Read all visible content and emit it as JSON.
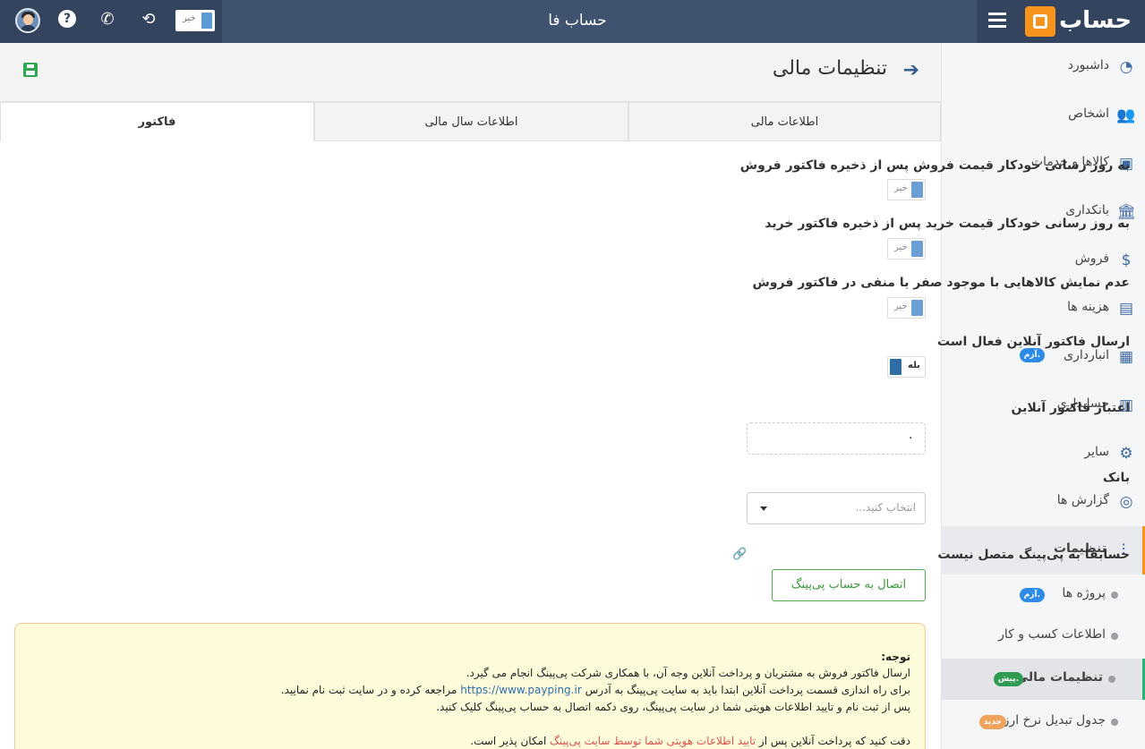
{
  "app_title": "حساب فا",
  "topbar": {
    "toggle_label": "خیر",
    "icons": [
      "avatar",
      "help-icon",
      "phone-icon",
      "refresh-icon"
    ]
  },
  "logo": {
    "text": "حساب"
  },
  "sidebar": {
    "items": [
      {
        "label": "داشبورد",
        "icon": "dashboard-icon"
      },
      {
        "label": "اشخاص",
        "icon": "people-icon"
      },
      {
        "label": "کالاها و خدمات",
        "icon": "box-icon"
      },
      {
        "label": "بانکداری",
        "icon": "bank-icon"
      },
      {
        "label": "فروش",
        "icon": "sales-icon"
      },
      {
        "label": "هزینه ها",
        "icon": "wallet-icon"
      },
      {
        "label": "انبارداری",
        "icon": "warehouse-icon",
        "badge": "آزم."
      },
      {
        "label": "حسابداری",
        "icon": "calculator-icon"
      },
      {
        "label": "سایر",
        "icon": "other-icon"
      },
      {
        "label": "گزارش ها",
        "icon": "report-icon"
      },
      {
        "label": "تنظیمات",
        "icon": "settings-icon"
      }
    ],
    "sub_items": [
      {
        "label": "پروژه ها",
        "badge": "آزم."
      },
      {
        "label": "اطلاعات کسب و کار"
      },
      {
        "label": "تنظیمات مالی",
        "badge": "پیش."
      },
      {
        "label": "جدول تبدیل نرخ ارز",
        "badge": "جدید"
      }
    ]
  },
  "page": {
    "title": "تنظیمات مالی"
  },
  "tabs": [
    {
      "label": "اطلاعات مالی"
    },
    {
      "label": "اطلاعات سال مالی"
    },
    {
      "label": "فاکتور"
    }
  ],
  "form": {
    "auto_update_sale_price": {
      "label": "به روز رسانی خودکار قیمت فروش پس از ذخیره فاکتور فروش",
      "value": "خیر"
    },
    "auto_update_purchase_price": {
      "label": "به روز رسانی خودکار قیمت خرید پس از ذخیره فاکتور خرید",
      "value": "خیر"
    },
    "hide_zero_stock": {
      "label": "عدم نمایش کالاهایی با موجود صفر یا منفی در فاکتور فروش",
      "value": "خیر"
    },
    "online_invoice_enabled": {
      "label": "ارسال فاکتور آنلاین فعال است",
      "value": "بله"
    },
    "online_invoice_credit": {
      "label": "اعتبار فاکتور آنلاین",
      "value": "۰"
    },
    "bank": {
      "label": "بانک",
      "placeholder": "انتخاب کنید..."
    },
    "payping_status": "حسابفا به پی‌پینگ متصل نیست",
    "connect_button": "اتصال به حساب پی‌پینگ"
  },
  "note": {
    "title": "توجه:",
    "line1": "ارسال فاکتور فروش به مشتریان و پرداخت آنلاین وجه آن، با همکاری شرکت پی‌پینگ انجام می گیرد.",
    "line2_pre": "برای راه اندازی قسمت پرداخت آنلاین ابتدا باید به سایت پی‌پینگ به آدرس",
    "line2_link": "https://www.payping.ir",
    "line2_post": "مراجعه کرده و در سایت ثبت نام نمایید.",
    "line3": "پس از ثبت نام و تایید اطلاعات هویتی شما در سایت پی‌پینگ، روی دکمه اتصال به حساب پی‌پینگ کلیک کنید.",
    "line4_pre": "دقت کنید که پرداخت آنلاین پس از",
    "line4_red": "تایید اطلاعات هویتی شما توسط سایت پی‌پینگ",
    "line4_post": "امکان پذیر است."
  },
  "colors": {
    "topbar": "#3f5270",
    "topbar_dark": "#34445e",
    "accent_orange": "#f7941d",
    "sidebar_icon": "#3f6aa1",
    "success": "#4cae4c",
    "note_bg": "#fdfbd9"
  }
}
